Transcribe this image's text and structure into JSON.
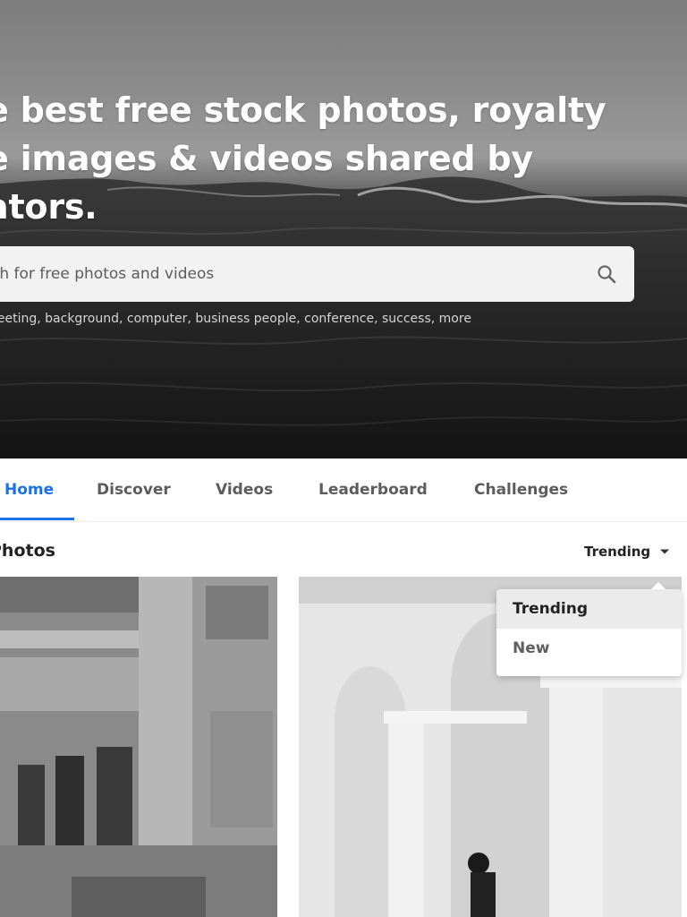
{
  "hero": {
    "title_lines": [
      "e best free stock photos, royalty",
      "e images & videos shared by",
      "ators."
    ],
    "search": {
      "placeholder": "ch for free photos and videos",
      "icon": "search-icon"
    },
    "suggestions": {
      "items": [
        "neeting",
        "background",
        "computer",
        "business people",
        "conference",
        "success",
        "more"
      ]
    }
  },
  "nav": {
    "tabs": [
      {
        "label": "Home",
        "active": true
      },
      {
        "label": "Discover"
      },
      {
        "label": "Videos"
      },
      {
        "label": "Leaderboard"
      },
      {
        "label": "Challenges"
      }
    ],
    "active_color": "#1a73e8"
  },
  "section": {
    "title": "Photos",
    "sort": {
      "selected": "Trending",
      "icon": "caret-down-icon",
      "options": [
        "Trending",
        "New"
      ]
    }
  }
}
